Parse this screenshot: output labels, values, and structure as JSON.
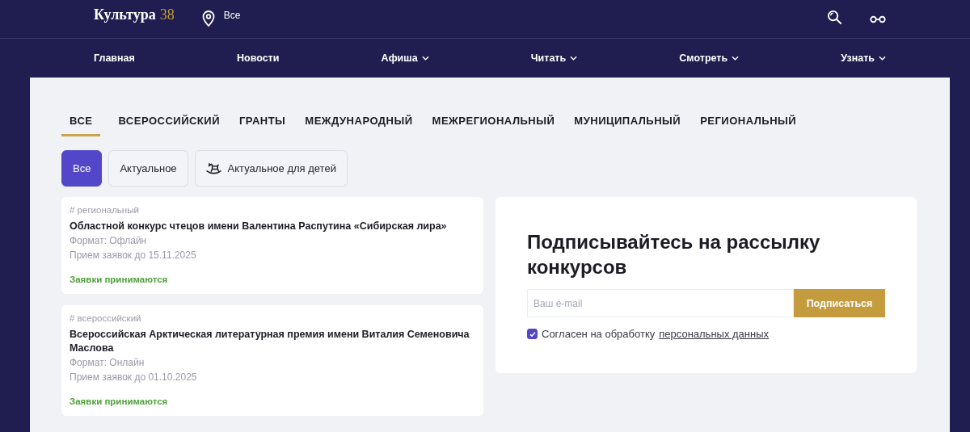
{
  "header": {
    "logo": {
      "name": "Культура",
      "number": "38"
    },
    "location": "Все"
  },
  "nav": [
    {
      "label": "Главная",
      "dropdown": false
    },
    {
      "label": "Новости",
      "dropdown": false
    },
    {
      "label": "Афиша",
      "dropdown": true
    },
    {
      "label": "Читать",
      "dropdown": true
    },
    {
      "label": "Смотреть",
      "dropdown": true
    },
    {
      "label": "Узнать",
      "dropdown": true
    }
  ],
  "tabs": [
    {
      "label": "ВСЕ",
      "selected": true
    },
    {
      "label": "ВСЕРОССИЙСКИЙ",
      "selected": false
    },
    {
      "label": "ГРАНТЫ",
      "selected": false
    },
    {
      "label": "МЕЖДУНАРОДНЫЙ",
      "selected": false
    },
    {
      "label": "МЕЖРЕГИОНАЛЬНЫЙ",
      "selected": false
    },
    {
      "label": "МУНИЦИПАЛЬНЫЙ",
      "selected": false
    },
    {
      "label": "РЕГИОНАЛЬНЫЙ",
      "selected": false
    }
  ],
  "filters": [
    {
      "label": "Все",
      "selected": true,
      "icon": false
    },
    {
      "label": "Актуальное",
      "selected": false,
      "icon": false
    },
    {
      "label": "Актуальное для детей",
      "selected": false,
      "icon": true
    }
  ],
  "contests": [
    {
      "tag": "# региональный",
      "title": "Областной конкурс чтецов имени Валентина Распутина «Сибирская лира»",
      "format": "Формат: Офлайн",
      "deadline": "Прием заявок до 15.11.2025",
      "status": "Заявки принимаются"
    },
    {
      "tag": "# всероссийский",
      "title": "Всероссийская Арктическая литературная премия имени Виталия Семеновича Маслова",
      "format": "Формат: Онлайн",
      "deadline": "Прием заявок до 01.10.2025",
      "status": "Заявки принимаются"
    }
  ],
  "subscribe": {
    "title": "Подписывайтесь на рассылку конкурсов",
    "placeholder": "Ваш e-mail",
    "button": "Подписаться",
    "consent": {
      "checked": true,
      "text": "Согласен на обработку",
      "link": "персональных данных"
    }
  }
}
